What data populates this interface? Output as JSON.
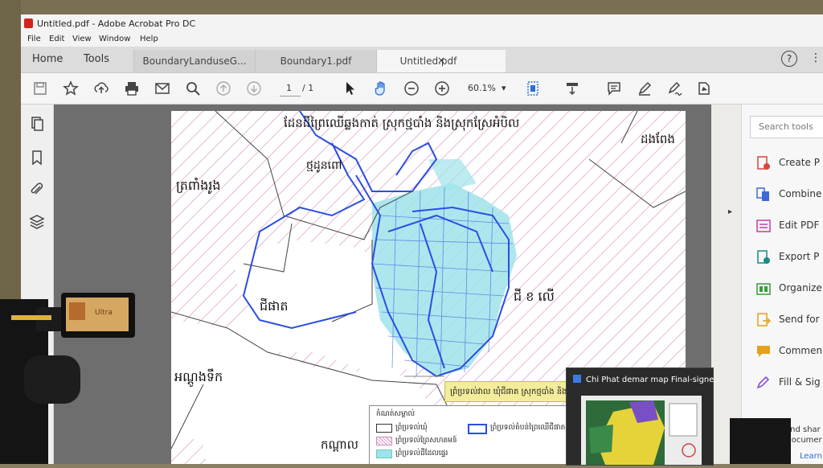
{
  "window": {
    "title": "Untitled.pdf - Adobe Acrobat Pro DC",
    "menu": [
      "File",
      "Edit",
      "View",
      "Window",
      "Help"
    ]
  },
  "nav": {
    "home": "Home",
    "tools": "Tools"
  },
  "tabs": [
    {
      "label": "BoundaryLanduseG...",
      "active": false
    },
    {
      "label": "Boundary1.pdf",
      "active": false
    },
    {
      "label": "Untitled.pdf",
      "active": true
    }
  ],
  "tab_close": "×",
  "help_label": "?",
  "more_label": "⋮",
  "toolbar": {
    "page_current": "1",
    "page_total": "/ 1",
    "zoom": "60.1%",
    "zoom_arrow": "▾"
  },
  "right_panel": {
    "search_placeholder": "Search tools",
    "tools": [
      {
        "label": "Create P",
        "color": "#d9453b"
      },
      {
        "label": "Combine",
        "color": "#3d6ad6"
      },
      {
        "label": "Edit PDF",
        "color": "#c63aa8"
      },
      {
        "label": "Export P",
        "color": "#1b8a84"
      },
      {
        "label": "Organize",
        "color": "#3b9a3b"
      },
      {
        "label": "Send for",
        "color": "#e3a21a"
      },
      {
        "label": "Commen",
        "color": "#e3a21a"
      },
      {
        "label": "Fill & Sig",
        "color": "#8a4fd6"
      }
    ],
    "share_text_1": "and shar",
    "share_text_2": "Documer",
    "learn_label": "Learn"
  },
  "map": {
    "heading": "ដែនដីព្រៃឈើឆ្លងកាត់ ស្រុកថ្មបាំង និងស្រុកស្រែអំបិល",
    "labels": {
      "top_village": "ថ្មដូនពៅ",
      "left_commune": "ត្រពាំងរូង",
      "right_top": "ដងពែង",
      "center_left": "ជីផាត",
      "center_right": "ជី ខ លើ",
      "bottom_left": "អណ្តូងទឹក",
      "bottom_center": "កណ្តាល"
    },
    "callout": "ព្រំប្រទល់វាល ឃុំជីផាត ស្រុកថ្មបាំង និងឃុំ ជី",
    "legend": {
      "title": "កំណត់សម្គាល់",
      "items": [
        "ព្រំប្រទល់ឃុំ",
        "ព្រំប្រទល់ព្រៃសហគមន៍",
        "ព្រំប្រទល់ដីដែលផ្ទេរ"
      ],
      "right_item": "ព្រំប្រទល់តំបន់ព្រៃឈើជីផាត ក្រុម"
    }
  },
  "popup": {
    "title": "Chi Phat demar map Final-signe..."
  },
  "camera": {
    "screen_text": "Ultra"
  },
  "colors": {
    "accent": "#2a6fd6",
    "map_blue": "#2b4ee0",
    "map_cyan": "#9fe3ea",
    "map_hatch": "#d18bc0",
    "callout_bg": "#f3ec9a"
  }
}
